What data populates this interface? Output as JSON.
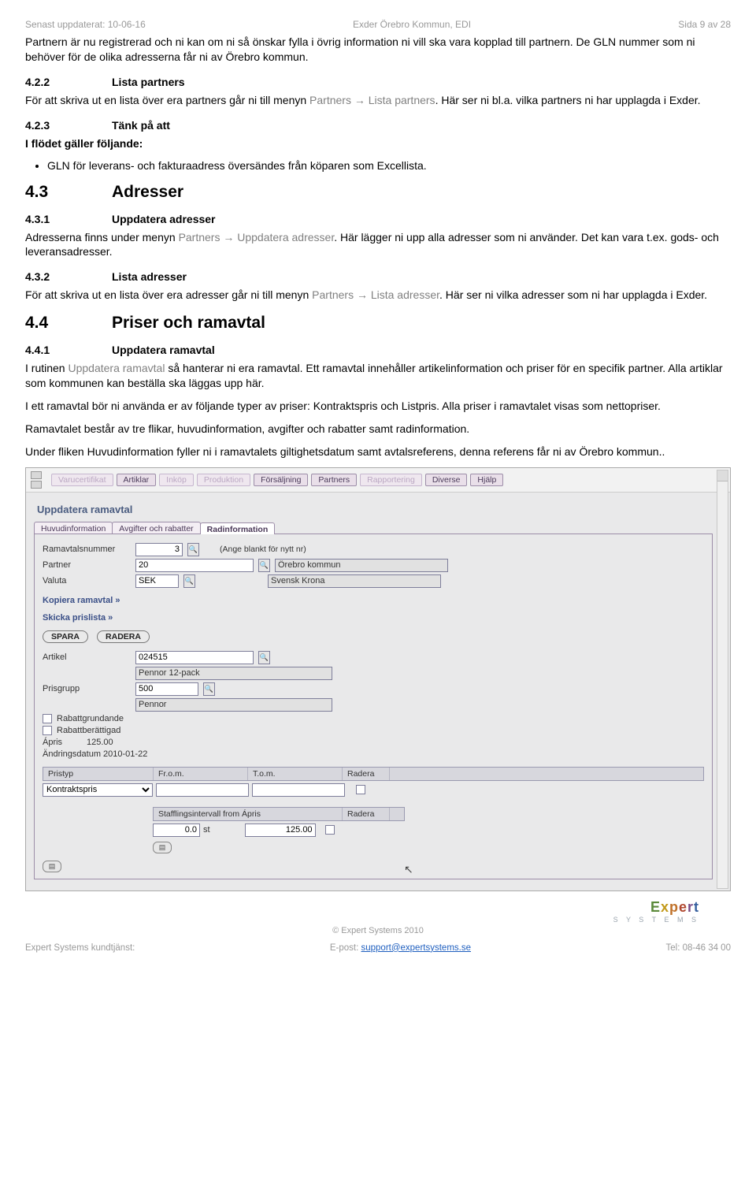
{
  "header": {
    "left": "Senast uppdaterat: 10-06-16",
    "center": "Exder Örebro Kommun, EDI",
    "right": "Sida 9 av 28"
  },
  "intro": {
    "p1a": "Partnern är nu registrerad och ni kan om ni så önskar fylla i övrig information ni vill ska vara kopplad till partnern. De GLN nummer som ni behöver för de olika adresserna får ni av Örebro kommun."
  },
  "s422": {
    "num": "4.2.2",
    "title": "Lista partners",
    "p_a": "För att skriva ut en lista över era partners går ni till menyn ",
    "p_link": "Partners → Lista partners",
    "p_b": ". Här ser ni bl.a. vilka partners ni har upplagda i Exder."
  },
  "s423": {
    "num": "4.2.3",
    "title": "Tänk på att",
    "lead": "I flödet gäller följande:",
    "bullet": "GLN för leverans- och fakturaadress översändes från köparen som Excellista."
  },
  "s43": {
    "num": "4.3",
    "title": "Adresser"
  },
  "s431": {
    "num": "4.3.1",
    "title": "Uppdatera adresser",
    "p_a": "Adresserna finns under menyn ",
    "p_link": "Partners → Uppdatera adresser",
    "p_b": ". Här lägger ni upp alla adresser som ni använder. Det kan vara t.ex. gods- och leveransadresser."
  },
  "s432": {
    "num": "4.3.2",
    "title": "Lista adresser",
    "p_a": "För att skriva ut en lista över era adresser går ni till menyn ",
    "p_link": "Partners → Lista adresser",
    "p_b": ". Här ser ni vilka adresser som ni har upplagda i Exder."
  },
  "s44": {
    "num": "4.4",
    "title": "Priser och ramavtal"
  },
  "s441": {
    "num": "4.4.1",
    "title": "Uppdatera ramavtal",
    "p1_a": "I rutinen ",
    "p1_link": "Uppdatera ramavtal",
    "p1_b": " så hanterar ni era ramavtal. Ett ramavtal innehåller artikelinformation och priser för en specifik partner. Alla artiklar som kommunen kan beställa ska läggas upp här.",
    "p2": "I ett ramavtal bör ni använda er av följande typer av priser: Kontraktspris och Listpris. Alla priser i ramavtalet visas som nettopriser.",
    "p3": "Ramavtalet består av tre flikar, huvudinformation, avgifter och rabatter samt radinformation.",
    "p4": "Under fliken Huvudinformation fyller ni i ramavtalets giltighetsdatum samt avtalsreferens, denna referens får ni av Örebro kommun.."
  },
  "app": {
    "menu": {
      "m1": "Varucertifikat",
      "m2": "Artiklar",
      "m3": "Inköp",
      "m4": "Produktion",
      "m5": "Försäljning",
      "m6": "Partners",
      "m7": "Rapportering",
      "m8": "Diverse",
      "m9": "Hjälp"
    },
    "title": "Uppdatera ramavtal",
    "tabs": {
      "t1": "Huvudinformation",
      "t2": "Avgifter och rabatter",
      "t3": "Radinformation"
    },
    "form": {
      "l_ramnr": "Ramavtalsnummer",
      "v_ramnr": "3",
      "note_ramnr": "(Ange blankt för nytt nr)",
      "l_partner": "Partner",
      "v_partner": "20",
      "ro_partner": "Örebro kommun",
      "l_valuta": "Valuta",
      "v_valuta": "SEK",
      "ro_valuta": "Svensk Krona",
      "link_kopiera": "Kopiera ramavtal »",
      "link_skicka": "Skicka prislista »",
      "btn_spara": "SPARA",
      "btn_radera": "RADERA",
      "l_artikel": "Artikel",
      "v_artikel": "024515",
      "ro_artikel": "Pennor 12-pack",
      "l_prisgrupp": "Prisgrupp",
      "v_prisgrupp": "500",
      "ro_prisgrupp": "Pennor",
      "chk_rabgrund": "Rabattgrundande",
      "chk_rabber": "Rabattberättigad",
      "l_apris": "Ápris",
      "v_apris": "125.00",
      "l_andring": "Ändringsdatum 2010-01-22",
      "gh_pristyp": "Pristyp",
      "gh_from": "Fr.o.m.",
      "gh_tom": "T.o.m.",
      "gh_radera": "Radera",
      "sel_pristyp": "Kontraktspris",
      "gh_staff": "Stafflingsintervall from Ápris",
      "gh_radera2": "Radera",
      "v_staff_from": "0.0",
      "u_staff": "st",
      "v_staff_apris": "125.00"
    }
  },
  "footer": {
    "copyright": "© Expert Systems 2010",
    "left": "Expert Systems kundtjänst:",
    "mid_a": "E-post: ",
    "mid_link": "support@expertsystems.se",
    "right": "Tel: 08-46 34 00",
    "logo_sub": "S Y S T E M S"
  }
}
